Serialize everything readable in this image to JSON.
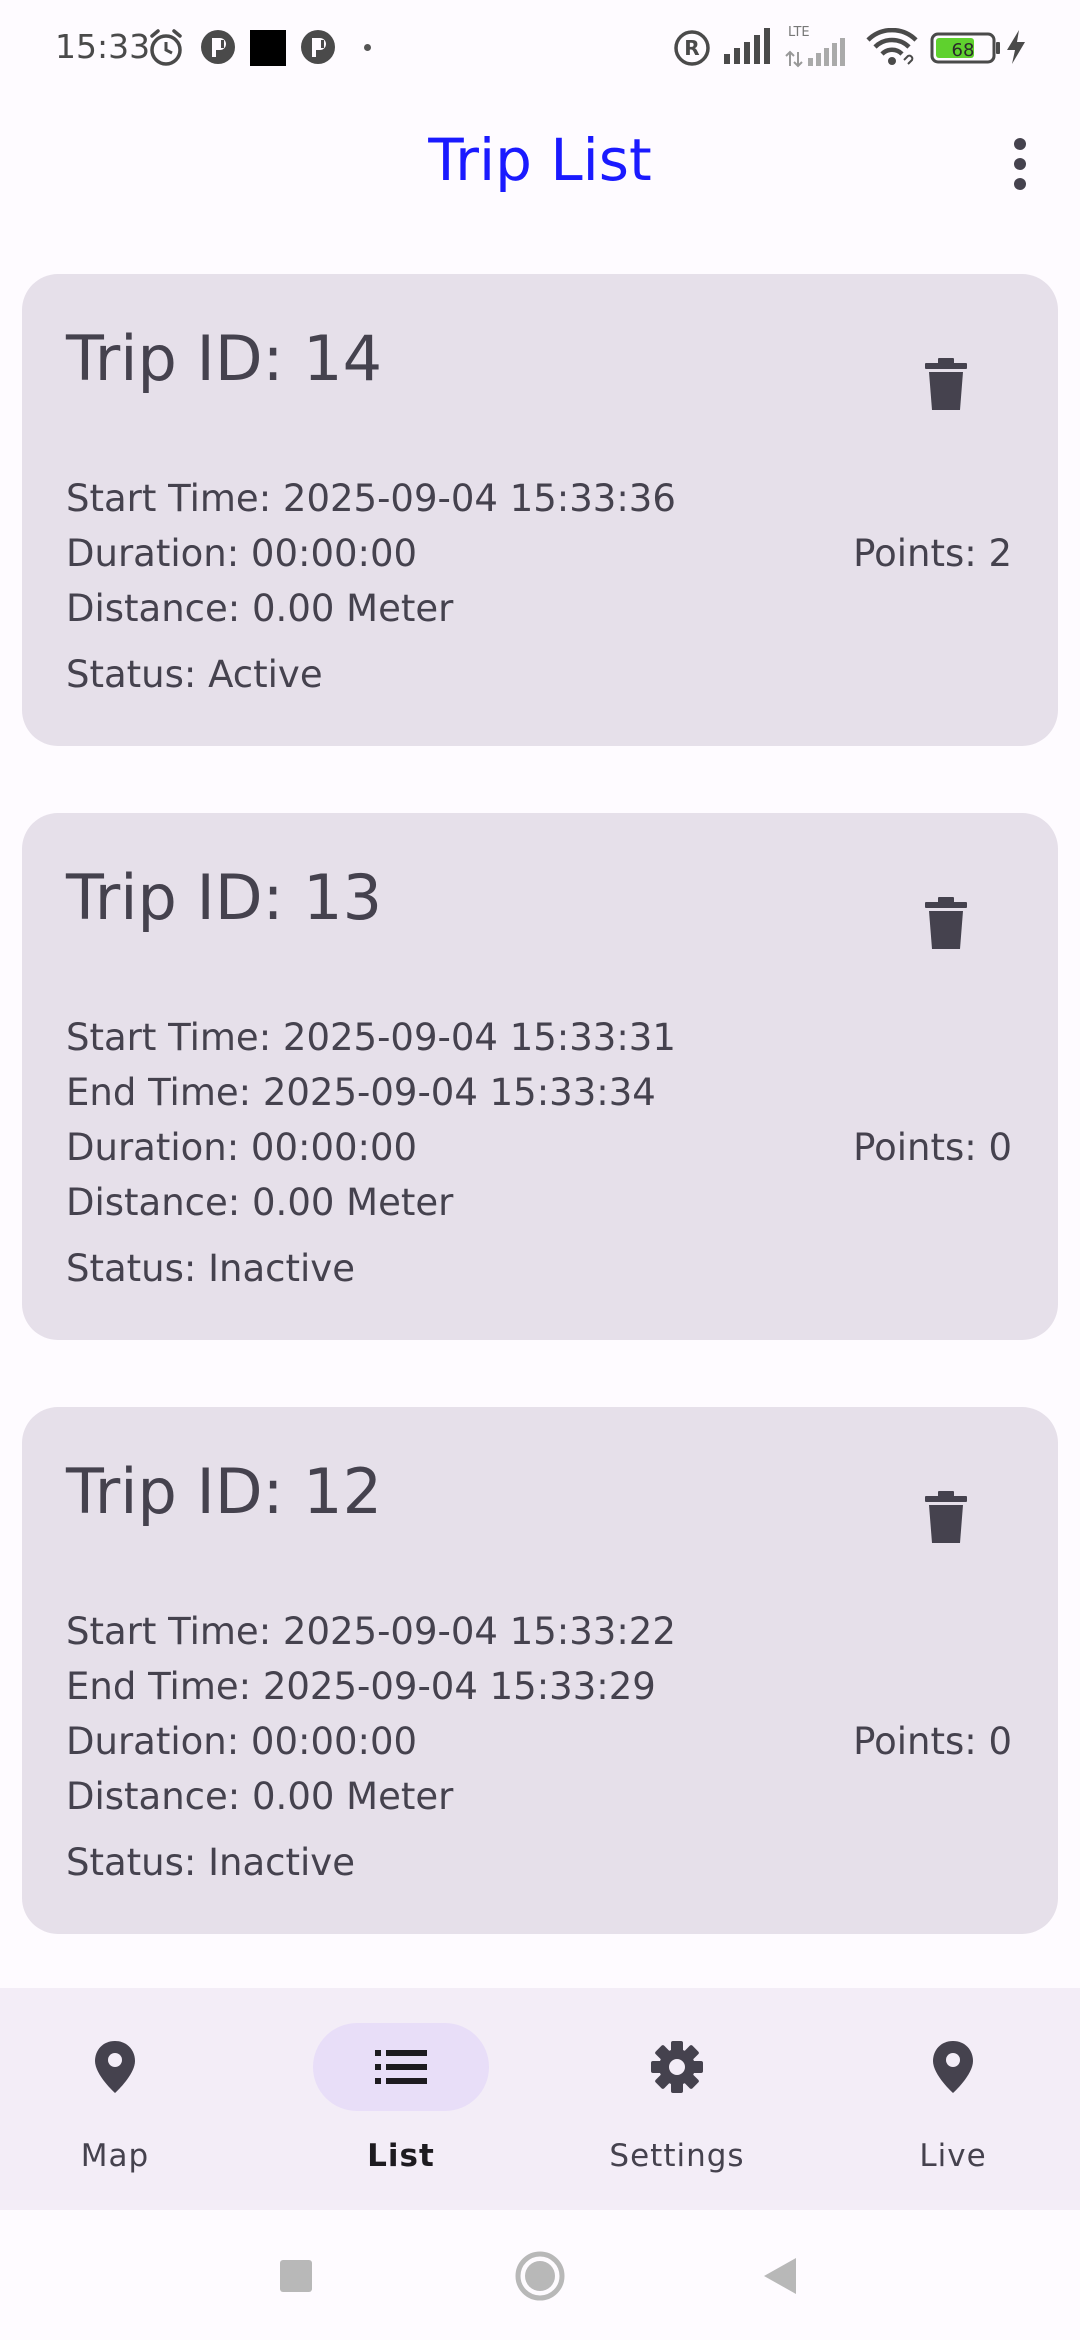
{
  "status_bar": {
    "time": "15:33",
    "battery": "68",
    "network": "LTE"
  },
  "app_bar": {
    "title": "Trip List"
  },
  "trips": [
    {
      "id_label": "Trip ID: 14",
      "start_time": "Start Time: 2025-09-04 15:33:36",
      "duration": "Duration: 00:00:00",
      "points": "Points: 2",
      "distance": "Distance: 0.00 Meter",
      "status": "Status: Active"
    },
    {
      "id_label": "Trip ID: 13",
      "start_time": "Start Time: 2025-09-04 15:33:31",
      "end_time": "End Time: 2025-09-04 15:33:34",
      "duration": "Duration: 00:00:00",
      "points": "Points: 0",
      "distance": "Distance: 0.00 Meter",
      "status": "Status: Inactive"
    },
    {
      "id_label": "Trip ID: 12",
      "start_time": "Start Time: 2025-09-04 15:33:22",
      "end_time": "End Time: 2025-09-04 15:33:29",
      "duration": "Duration: 00:00:00",
      "points": "Points: 0",
      "distance": "Distance: 0.00 Meter",
      "status": "Status: Inactive"
    }
  ],
  "bottom_nav": {
    "items": [
      {
        "label": "Map",
        "icon": "location-pin-icon",
        "active": false
      },
      {
        "label": "List",
        "icon": "list-icon",
        "active": true
      },
      {
        "label": "Settings",
        "icon": "gear-icon",
        "active": false
      },
      {
        "label": "Live",
        "icon": "location-pin-icon",
        "active": false
      }
    ]
  },
  "colors": {
    "title": "#1a1aff",
    "card_bg": "#e6e0ea",
    "nav_bg": "#f3edf7",
    "nav_active_indicator": "#e8def8",
    "page_bg": "#fefbff"
  }
}
